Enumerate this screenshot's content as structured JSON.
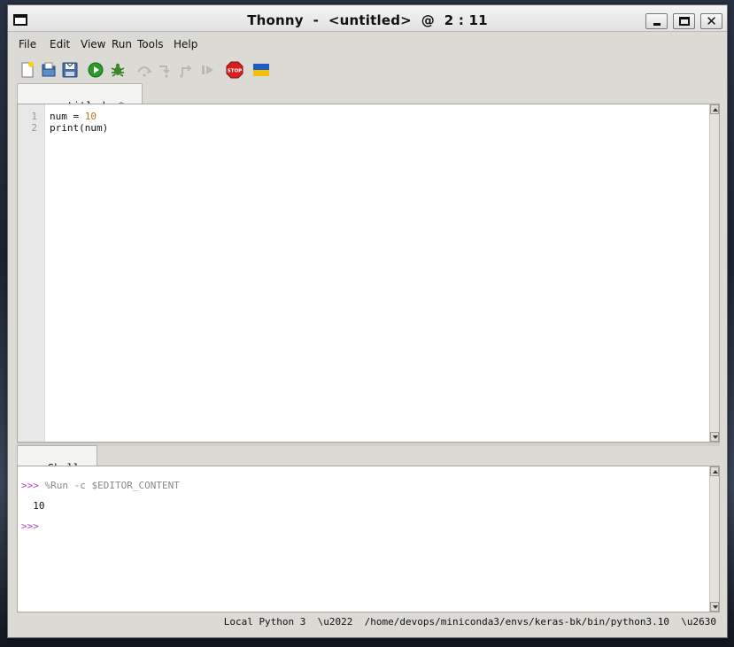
{
  "window": {
    "title": "Thonny  -  <untitled>  @  2 : 11",
    "buttons": {
      "minimize": "_",
      "maximize": "",
      "close": "✕"
    }
  },
  "menubar": [
    "File",
    "Edit",
    "View",
    "Run",
    "Tools",
    "Help"
  ],
  "toolbar": [
    {
      "name": "new-file-icon",
      "enabled": true
    },
    {
      "name": "open-file-icon",
      "enabled": true
    },
    {
      "name": "save-file-icon",
      "enabled": true
    },
    {
      "name": "run-icon",
      "enabled": true
    },
    {
      "name": "debug-icon",
      "enabled": true
    },
    {
      "name": "step-over-icon",
      "enabled": false
    },
    {
      "name": "step-into-icon",
      "enabled": false
    },
    {
      "name": "step-out-icon",
      "enabled": false
    },
    {
      "name": "resume-icon",
      "enabled": false
    },
    {
      "name": "stop-icon",
      "enabled": true,
      "label": "STOP"
    },
    {
      "name": "ukraine-flag-icon",
      "enabled": true
    }
  ],
  "editor": {
    "tab_label": "<untitled> *",
    "tab_close": "×",
    "lines": [
      {
        "number": "1",
        "code_pre": "num = ",
        "code_lit": "10",
        "code_post": ""
      },
      {
        "number": "2",
        "code_pre": "print(num)",
        "code_lit": "",
        "code_post": ""
      }
    ]
  },
  "shell": {
    "tab_label": "Shell",
    "tab_close": "×",
    "lines": [
      {
        "prompt": ">>> ",
        "text": "%Run -c $EDITOR_CONTENT",
        "kind": "cmd"
      },
      {
        "prompt": "",
        "text": "  10",
        "kind": "out"
      },
      {
        "prompt": ">>>",
        "text": "",
        "kind": "prompt"
      }
    ]
  },
  "statusbar": {
    "text": "Local Python 3  \\u2022  /home/devops/miniconda3/envs/keras-bk/bin/python3.10  \\u2630"
  },
  "colors": {
    "prompt": "#b23cc8",
    "number_literal": "#c0701a",
    "command": "#8a8a8a",
    "run_green": "#2a9a2a",
    "stop_red": "#d42020"
  }
}
